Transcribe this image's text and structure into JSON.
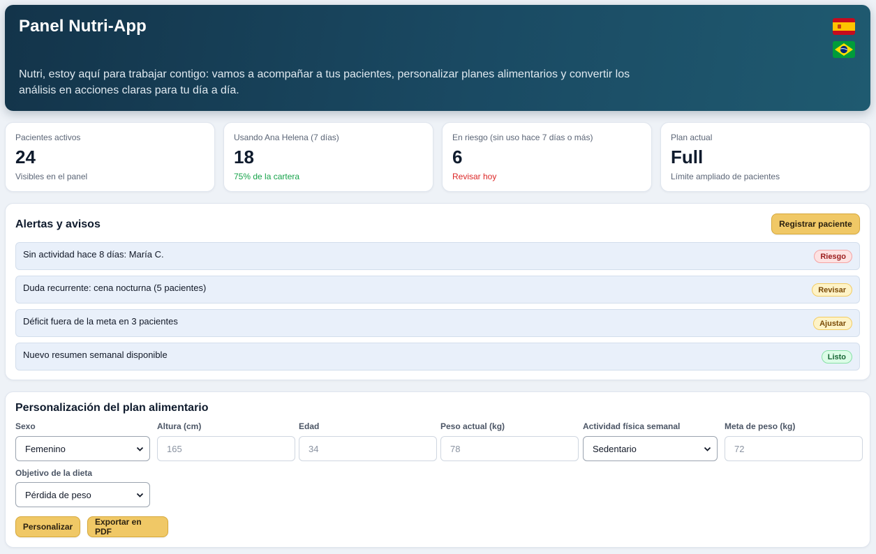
{
  "header": {
    "title": "Panel Nutri-App",
    "intro": "Nutri, estoy aquí para trabajar contigo: vamos a acompañar a tus pacientes, personalizar planes alimentarios y convertir los análisis en acciones claras para tu día a día.",
    "languages": [
      {
        "icon": "spain-flag-icon"
      },
      {
        "icon": "brazil-flag-icon"
      }
    ]
  },
  "stats": [
    {
      "label": "Pacientes activos",
      "value": "24",
      "note": "Visibles en el panel",
      "note_color": "#5b6576"
    },
    {
      "label": "Usando Ana Helena (7 días)",
      "value": "18",
      "note": "75% de la cartera",
      "note_color": "#16a34a"
    },
    {
      "label": "En riesgo (sin uso hace 7 días o más)",
      "value": "6",
      "note": "Revisar hoy",
      "note_color": "#dc2626"
    },
    {
      "label": "Plan actual",
      "value": "Full",
      "note": "Límite ampliado de pacientes",
      "note_color": "#5b6576"
    }
  ],
  "alerts": {
    "title": "Alertas y avisos",
    "register_button": "Registrar paciente",
    "items": [
      {
        "text": "Sin actividad hace 8 días: María C.",
        "badge": "Riesgo",
        "status": "risk",
        "color": "#dc2626"
      },
      {
        "text": "Duda recurrente: cena nocturna (5 pacientes)",
        "badge": "Revisar",
        "status": "review",
        "color": "#d97706"
      },
      {
        "text": "Déficit fuera de la meta en 3 pacientes",
        "badge": "Ajustar",
        "status": "adjust",
        "color": "#d97706"
      },
      {
        "text": "Nuevo resumen semanal disponible",
        "badge": "Listo",
        "status": "ready",
        "color": "#16a34a"
      }
    ]
  },
  "plan": {
    "title": "Personalización del plan alimentario",
    "fields": {
      "sex": {
        "label": "Sexo",
        "value": "Femenino"
      },
      "height": {
        "label": "Altura (cm)",
        "placeholder": "165"
      },
      "age": {
        "label": "Edad",
        "placeholder": "34"
      },
      "weight": {
        "label": "Peso actual (kg)",
        "placeholder": "78"
      },
      "activity": {
        "label": "Actividad física semanal",
        "value": "Sedentario"
      },
      "goal_weight": {
        "label": "Meta de peso (kg)",
        "placeholder": "72"
      },
      "objective": {
        "label": "Objetivo de la dieta",
        "value": "Pérdida de peso"
      }
    },
    "buttons": {
      "personalize": "Personalizar",
      "export": "Exportar en PDF"
    }
  },
  "colors": {
    "header_gradient_start": "#13344a",
    "header_gradient_end": "#1f5a70",
    "accent_button": "#f0c866",
    "alert_row_bg": "#e9f0fa"
  }
}
